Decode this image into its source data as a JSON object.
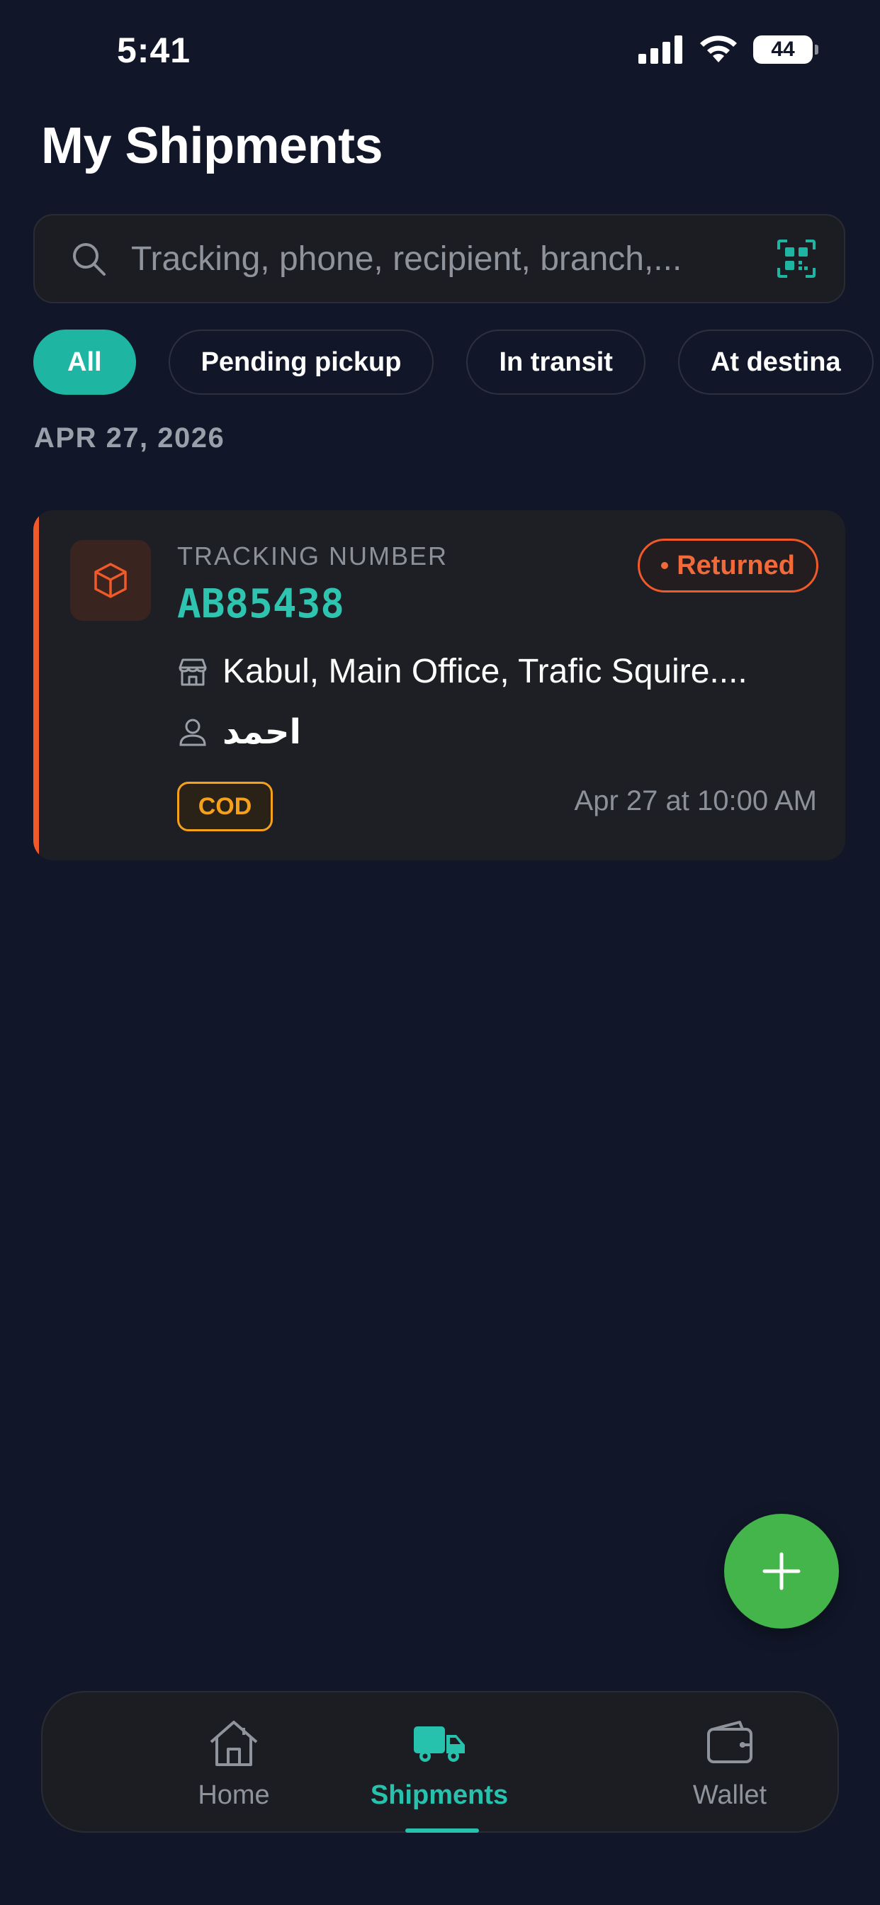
{
  "status_bar": {
    "time": "5:41",
    "battery": "44"
  },
  "page": {
    "title": "My Shipments"
  },
  "search": {
    "placeholder": "Tracking, phone, recipient, branch,..."
  },
  "filters": [
    {
      "label": "All",
      "active": true
    },
    {
      "label": "Pending pickup",
      "active": false
    },
    {
      "label": "In transit",
      "active": false
    },
    {
      "label": "At destina",
      "active": false
    }
  ],
  "groups": [
    {
      "date": "APR 27, 2026",
      "shipments": [
        {
          "tracking_label": "TRACKING NUMBER",
          "tracking_number": "AB85438",
          "status": "Returned",
          "branch": "Kabul, Main Office, Trafic Squire....",
          "recipient": "احمد",
          "payment": "COD",
          "time": "Apr 27 at 10:00 AM"
        }
      ]
    }
  ],
  "nav": {
    "home": "Home",
    "shipments": "Shipments",
    "wallet": "Wallet"
  },
  "colors": {
    "background": "#111729",
    "accent": "#1fb5a3",
    "returned": "#f05a28",
    "cod": "#f5a11c",
    "fab": "#43b54a"
  }
}
